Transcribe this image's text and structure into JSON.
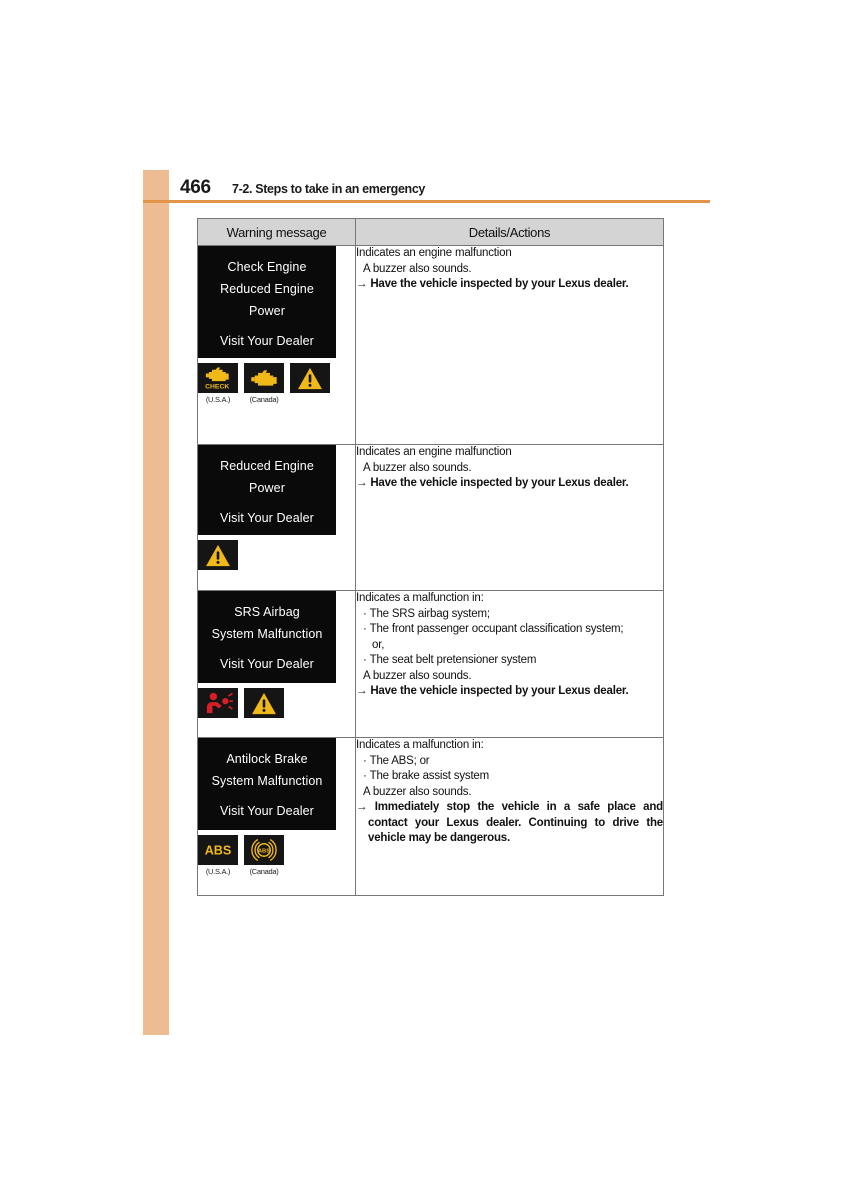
{
  "page": {
    "number": "466",
    "section_title": "7-2. Steps to take in an emergency",
    "accent_color": "#e3944b",
    "margin_strip_color": "#eebc93"
  },
  "table": {
    "headers": {
      "warning_message": "Warning message",
      "details_actions": "Details/Actions"
    },
    "rows": [
      {
        "display": {
          "lines": [
            "Check Engine",
            "Reduced Engine",
            "Power"
          ],
          "footer": "Visit Your Dealer"
        },
        "icons": [
          {
            "name": "check-engine-usa-icon",
            "caption": "(U.S.A.)",
            "type": "check-engine-check"
          },
          {
            "name": "check-engine-canada-icon",
            "caption": "(Canada)",
            "type": "check-engine"
          },
          {
            "name": "master-warning-icon",
            "caption": "",
            "type": "warning-triangle"
          }
        ],
        "details": {
          "intro": "Indicates an engine malfunction",
          "bullets": [],
          "buzzer": "A buzzer also sounds.",
          "action_arrow": "→",
          "action": "Have the vehicle inspected by your Lexus dealer.",
          "action_wraps": false
        }
      },
      {
        "display": {
          "lines": [
            "Reduced Engine",
            "Power"
          ],
          "footer": "Visit Your Dealer"
        },
        "icons": [
          {
            "name": "master-warning-icon",
            "caption": "",
            "type": "warning-triangle"
          }
        ],
        "details": {
          "intro": "Indicates an engine malfunction",
          "bullets": [],
          "buzzer": "A buzzer also sounds.",
          "action_arrow": "→",
          "action": "Have the vehicle inspected by your Lexus dealer.",
          "action_wraps": false
        }
      },
      {
        "display": {
          "lines": [
            "SRS Airbag",
            "System Malfunction"
          ],
          "footer": "Visit Your Dealer"
        },
        "icons": [
          {
            "name": "srs-airbag-icon",
            "caption": "",
            "type": "srs-airbag"
          },
          {
            "name": "master-warning-icon",
            "caption": "",
            "type": "warning-triangle"
          }
        ],
        "details": {
          "intro": "Indicates a malfunction in:",
          "bullets": [
            "The SRS airbag system;",
            "The front passenger occupant classification system;",
            "or,",
            "The seat belt pretensioner system"
          ],
          "bullet_continuation_index": 2,
          "buzzer": "A buzzer also sounds.",
          "action_arrow": "→",
          "action": "Have the vehicle inspected by your Lexus dealer.",
          "action_wraps": false
        }
      },
      {
        "display": {
          "lines": [
            "Antilock Brake",
            "System Malfunction"
          ],
          "footer": "Visit Your Dealer"
        },
        "icons": [
          {
            "name": "abs-usa-icon",
            "caption": "(U.S.A.)",
            "type": "abs-text"
          },
          {
            "name": "abs-canada-icon",
            "caption": "(Canada)",
            "type": "abs-circle"
          }
        ],
        "details": {
          "intro": "Indicates a malfunction in:",
          "bullets": [
            "The ABS; or",
            "The brake assist system"
          ],
          "buzzer": "A buzzer also sounds.",
          "action_arrow": "→",
          "action": "Immediately stop the vehicle in a safe place and contact your Lexus dealer. Continuing to drive the vehicle may be dangerous.",
          "action_wraps": true
        }
      }
    ]
  }
}
